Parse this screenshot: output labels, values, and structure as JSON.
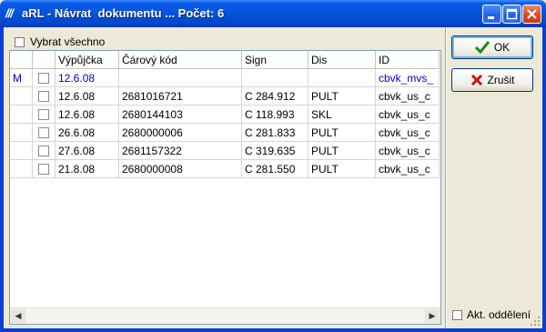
{
  "window": {
    "app_icon": "///",
    "title": "aRL - Návrat  dokumentu ... Počet: 6"
  },
  "select_all_label": "Vybrat všechno",
  "grid": {
    "columns": [
      "",
      "",
      "Výpůjčka",
      "Čárový kód",
      "Sign",
      "Dis",
      "ID"
    ],
    "rows": [
      {
        "mark": "M",
        "date": "12.6.08",
        "barcode": "",
        "sign": "",
        "dis": "",
        "id": "cbvk_mvs_",
        "highlight": true
      },
      {
        "mark": "",
        "date": "12.6.08",
        "barcode": "2681016721",
        "sign": "C 284.912",
        "dis": "PULT",
        "id": "cbvk_us_c",
        "highlight": false
      },
      {
        "mark": "",
        "date": "12.6.08",
        "barcode": "2680144103",
        "sign": "C 118.993",
        "dis": "SKL",
        "id": "cbvk_us_c",
        "highlight": false
      },
      {
        "mark": "",
        "date": "26.6.08",
        "barcode": "2680000006",
        "sign": "C 281.833",
        "dis": "PULT",
        "id": "cbvk_us_c",
        "highlight": false
      },
      {
        "mark": "",
        "date": "27.6.08",
        "barcode": "2681157322",
        "sign": "C 319.635",
        "dis": "PULT",
        "id": "cbvk_us_c",
        "highlight": false
      },
      {
        "mark": "",
        "date": "21.8.08",
        "barcode": "2680000008",
        "sign": "C 281.550",
        "dis": "PULT",
        "id": "cbvk_us_c",
        "highlight": false
      }
    ]
  },
  "buttons": {
    "ok": "OK",
    "cancel": "Zrušit"
  },
  "dept_label": "Akt. oddělení",
  "colors": {
    "highlight_text": "#0000cc",
    "ok_icon": "#1a8a1a",
    "cancel_icon": "#cc1010"
  }
}
